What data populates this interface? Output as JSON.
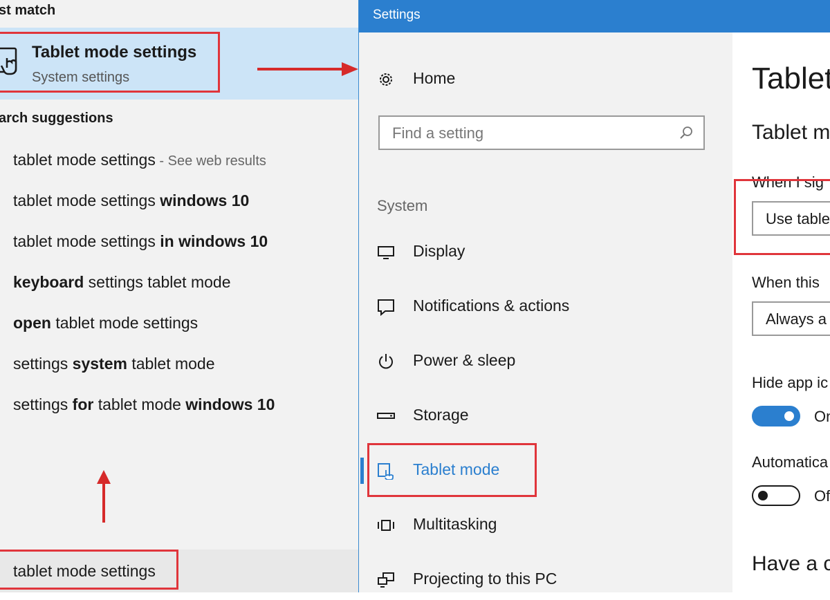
{
  "search": {
    "best_match_header": "st match",
    "best_match": {
      "title": "Tablet mode settings",
      "subtitle": "System settings",
      "icon": "tablet-touch-icon"
    },
    "suggestions_header": "arch suggestions",
    "suggestions": [
      {
        "normal": "tablet mode settings",
        "bold": "",
        "suffix": "",
        "web": " - See web results"
      },
      {
        "normal": "tablet mode settings ",
        "bold": "windows 10",
        "suffix": "",
        "web": ""
      },
      {
        "normal": "tablet mode settings ",
        "bold": "in windows 10",
        "suffix": "",
        "web": ""
      },
      {
        "prefix_bold": "keyboard",
        "normal": " settings tablet mode"
      },
      {
        "prefix_bold": "open",
        "normal": " tablet mode settings"
      },
      {
        "pre": "settings ",
        "mid_bold": "system",
        "post": " tablet mode"
      },
      {
        "pre": "settings ",
        "mid_bold": "for",
        "post": " tablet mode ",
        "end_bold": "windows 10"
      }
    ],
    "query": "tablet mode settings"
  },
  "settings": {
    "window_title": "Settings",
    "home_label": "Home",
    "find_placeholder": "Find a setting",
    "group_label": "System",
    "nav_items": [
      {
        "label": "Display",
        "icon": "display-icon"
      },
      {
        "label": "Notifications & actions",
        "icon": "notifications-icon"
      },
      {
        "label": "Power & sleep",
        "icon": "power-icon"
      },
      {
        "label": "Storage",
        "icon": "storage-icon"
      },
      {
        "label": "Tablet mode",
        "icon": "tablet-mode-icon",
        "active": true
      },
      {
        "label": "Multitasking",
        "icon": "multitasking-icon"
      },
      {
        "label": "Projecting to this PC",
        "icon": "projecting-icon"
      }
    ],
    "content": {
      "page_title": "Tablet",
      "section_title": "Tablet m",
      "signin_label": "When I sig",
      "signin_value": "Use table",
      "device_label": "When this",
      "device_value": "Always a",
      "hide_icons_label": "Hide app ic",
      "hide_icons_state": "On",
      "auto_label": "Automatica",
      "auto_state": "Of",
      "question": "Have a c"
    }
  },
  "colors": {
    "accent": "#2b7fcf",
    "highlight": "#e0353b",
    "selection": "#cce4f7"
  }
}
